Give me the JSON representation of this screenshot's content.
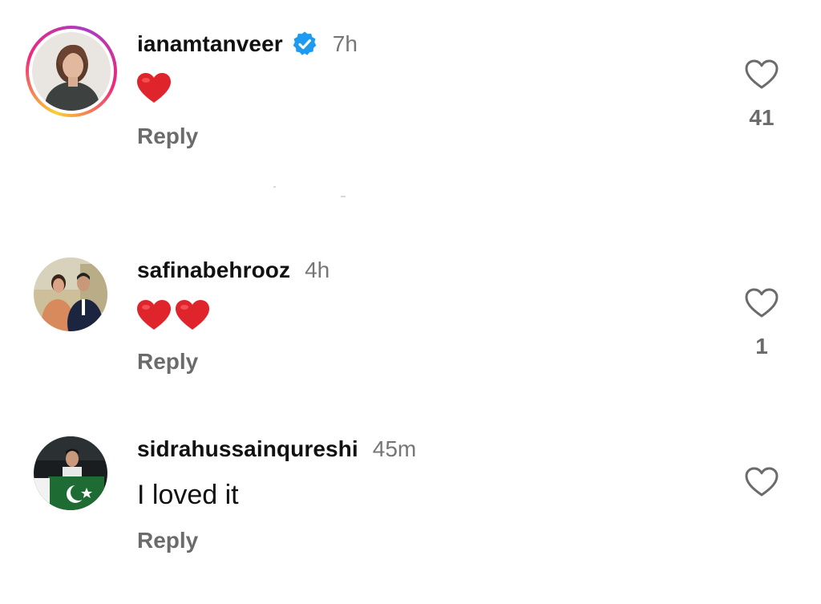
{
  "comments": [
    {
      "username": "ianamtanveer",
      "verified": true,
      "time": "7h",
      "body_type": "emoji",
      "emoji_count": 1,
      "emoji_name": "red-heart",
      "reply_label": "Reply",
      "likes": "41"
    },
    {
      "username": "safinabehrooz",
      "verified": false,
      "time": "4h",
      "body_type": "emoji",
      "emoji_count": 2,
      "emoji_name": "red-heart",
      "reply_label": "Reply",
      "likes": "1"
    },
    {
      "username": "sidrahussainqureshi",
      "verified": false,
      "time": "45m",
      "body_type": "text",
      "text": "I loved it",
      "reply_label": "Reply",
      "likes": ""
    }
  ],
  "icons": {
    "like": "heart-outline-icon",
    "verified": "verified-badge-icon",
    "emoji": "red-heart-emoji"
  },
  "colors": {
    "verified_blue": "#1d9bf0",
    "heart_red": "#e0242c",
    "secondary_text": "#6b6b6b",
    "story_ring_start": "#f9ce34",
    "story_ring_end": "#ee2a7b"
  }
}
